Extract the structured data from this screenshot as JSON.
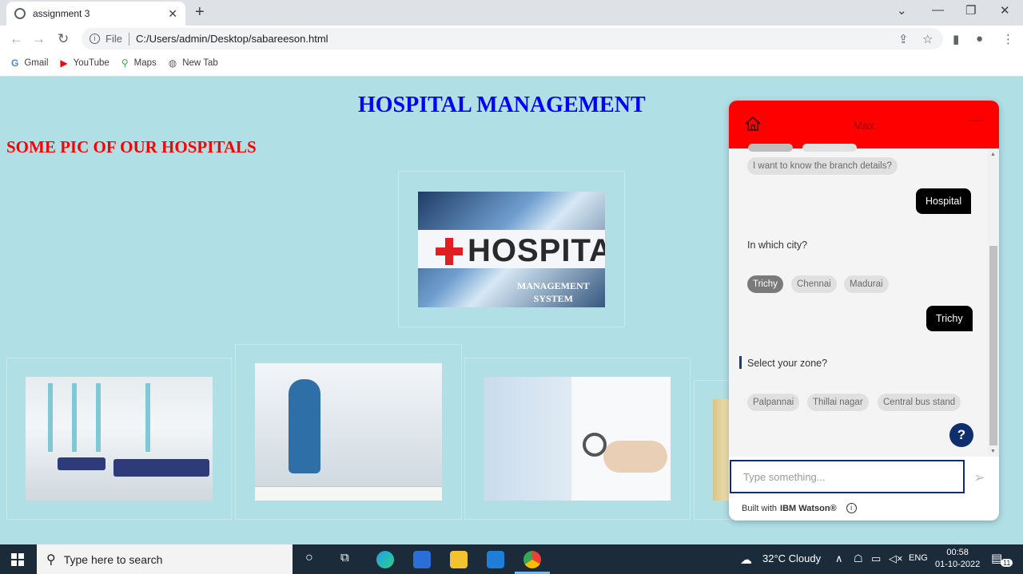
{
  "browser": {
    "tab_title": "assignment 3",
    "url_scheme": "File",
    "url": "C:/Users/admin/Desktop/sabareeson.html",
    "bookmarks": [
      {
        "label": "Gmail",
        "icon": "google-icon"
      },
      {
        "label": "YouTube",
        "icon": "youtube-icon"
      },
      {
        "label": "Maps",
        "icon": "maps-icon"
      },
      {
        "label": "New Tab",
        "icon": "globe-icon"
      }
    ]
  },
  "page": {
    "title": "HOSPITAL MANAGEMENT",
    "subtitle": "SOME PIC OF OUR HOSPITALS",
    "sign_word": "HOSPITAL",
    "sign_sub_line1": "MANAGEMENT",
    "sign_sub_line2": "SYSTEM"
  },
  "chat": {
    "bot_name": "Max",
    "option_prev": "I want to know the branch details?",
    "user_msg_1": "Hospital",
    "bot_msg_1": "In which city?",
    "city_options": [
      "Trichy",
      "Chennai",
      "Madurai"
    ],
    "user_msg_2": "Trichy",
    "bot_msg_2": "Select your zone?",
    "zone_options": [
      "Palpannai",
      "Thillai nagar",
      "Central bus stand"
    ],
    "help_label": "?",
    "input_placeholder": "Type something...",
    "footer_prefix": "Built with",
    "footer_brand": "IBM Watson®"
  },
  "taskbar": {
    "search_placeholder": "Type here to search",
    "weather": "32°C  Cloudy",
    "language": "ENG",
    "time": "00:58",
    "date": "01-10-2022",
    "notification_count": "11"
  }
}
